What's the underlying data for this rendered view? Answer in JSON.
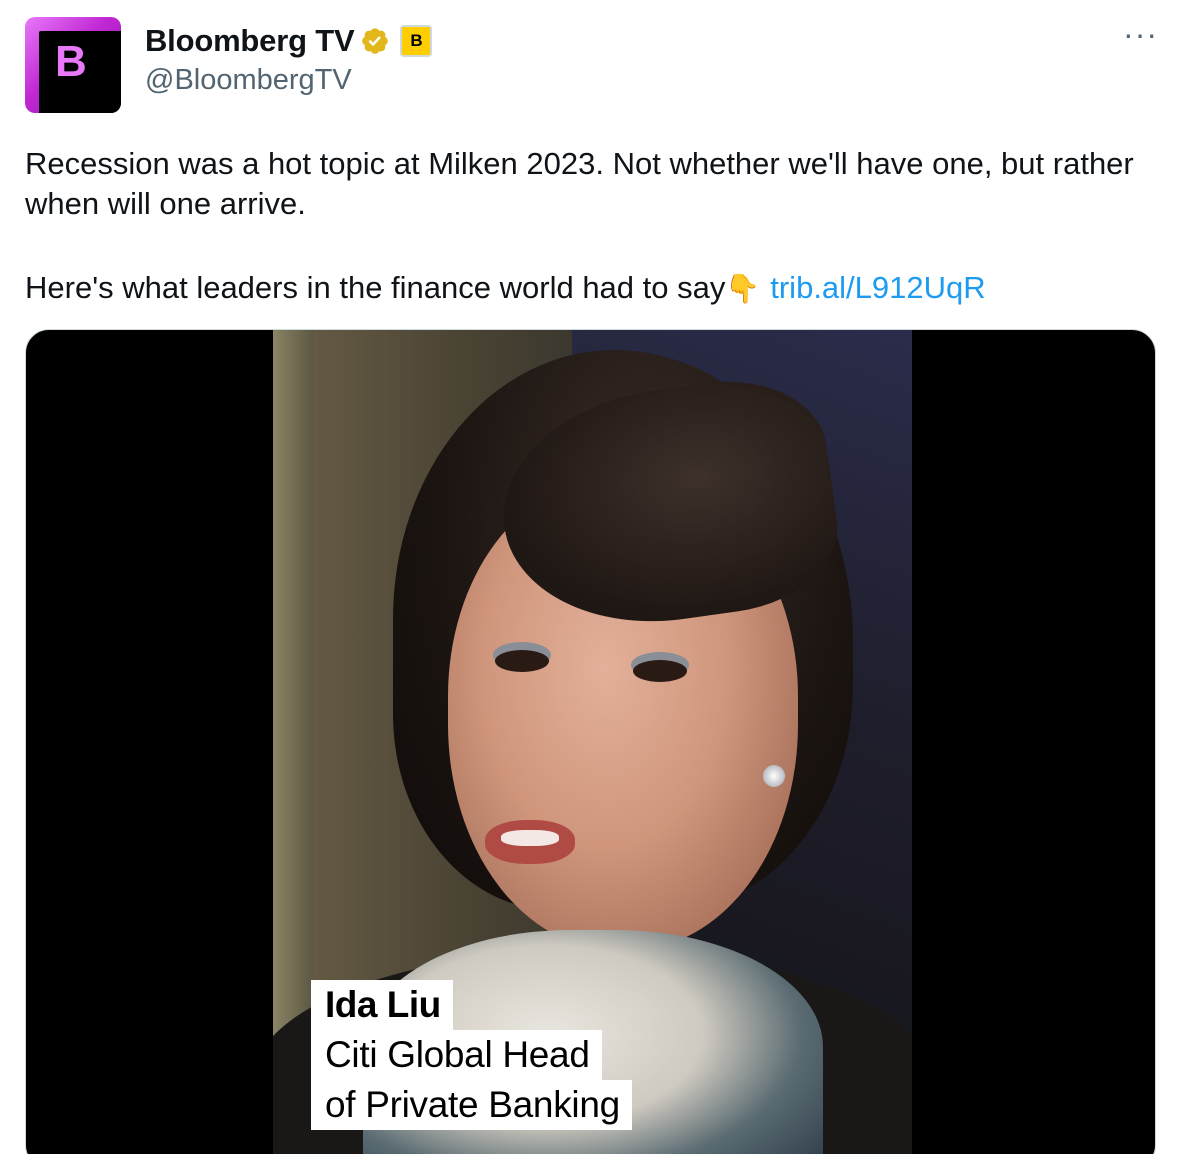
{
  "header": {
    "avatar_letter": "B",
    "display_name": "Bloomberg TV",
    "handle": "@BloombergTV",
    "affiliate_badge": "B",
    "more_label": "···"
  },
  "tweet": {
    "line1": "Recession was a hot topic at Milken 2023. Not whether we'll have one, but rather when will one arrive.",
    "line2_text": "Here's what leaders in the finance world had to say",
    "line2_emoji": "👇",
    "link_text": "trib.al/L912UqR"
  },
  "media": {
    "caption_name": "Ida Liu",
    "caption_title_1": "Citi Global Head",
    "caption_title_2": "of Private Banking"
  },
  "colors": {
    "link": "#1d9bf0",
    "verified": "#e2b719",
    "avatar_accent": "#e879f9"
  },
  "icons": [
    "verified-badge-icon",
    "affiliate-badge-icon",
    "more-options-icon",
    "backhand-index-down-emoji"
  ]
}
